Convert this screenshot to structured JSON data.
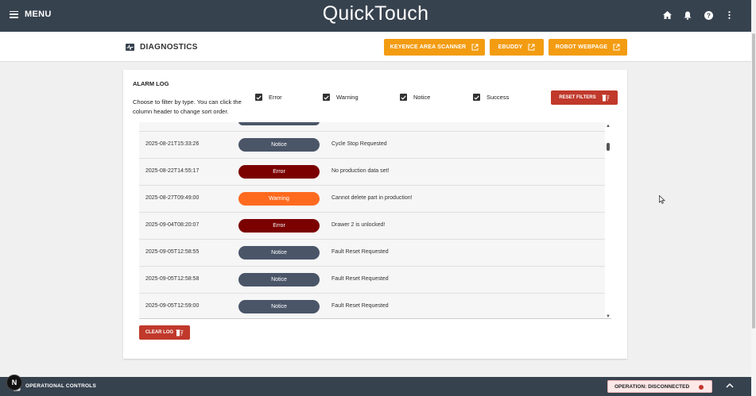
{
  "app": {
    "title": "QuickTouch",
    "menu_label": "MENU"
  },
  "topbar_icons": [
    "home-icon",
    "bell-icon",
    "help-icon",
    "more-vertical-icon"
  ],
  "page": {
    "title": "DIAGNOSTICS",
    "buttons": {
      "keyence": "KEYENCE AREA SCANNER",
      "ebuddy": "EBUDDY",
      "robot": "ROBOT WEBPAGE"
    }
  },
  "alarm_log": {
    "title": "ALARM LOG",
    "description": "Choose to filter by type. You can click the column header to change sort order.",
    "filters": {
      "error": "Error",
      "warning": "Warning",
      "notice": "Notice",
      "success": "Success"
    },
    "reset_label": "RESET FILTERS",
    "clear_label": "CLEAR LOG",
    "rows": [
      {
        "timestamp": "2025-08-21T15:33:26",
        "type": "Notice",
        "message": "Cycle Stop Requested"
      },
      {
        "timestamp": "2025-08-22T14:55:17",
        "type": "Error",
        "message": "No production data set!"
      },
      {
        "timestamp": "2025-08-27T09:49:00",
        "type": "Warning",
        "message": "Cannot delete part in production!"
      },
      {
        "timestamp": "2025-09-04T08:20:07",
        "type": "Error",
        "message": "Drawer 2 is unlocked!"
      },
      {
        "timestamp": "2025-09-05T12:58:55",
        "type": "Notice",
        "message": "Fault Reset Requested"
      },
      {
        "timestamp": "2025-09-05T12:58:58",
        "type": "Notice",
        "message": "Fault Reset Requested"
      },
      {
        "timestamp": "2025-09-05T12:59:00",
        "type": "Notice",
        "message": "Fault Reset Requested"
      }
    ]
  },
  "bottom_bar": {
    "label": "OPERATIONAL CONTROLS",
    "status": "OPERATION: DISCONNECTED",
    "badge": "N"
  },
  "colors": {
    "header_bg": "#37424f",
    "accent_orange": "#f39c12",
    "danger_red": "#c0392b",
    "notice": "#4a5568",
    "error": "#7b0000",
    "warning": "#ff6a1f"
  }
}
